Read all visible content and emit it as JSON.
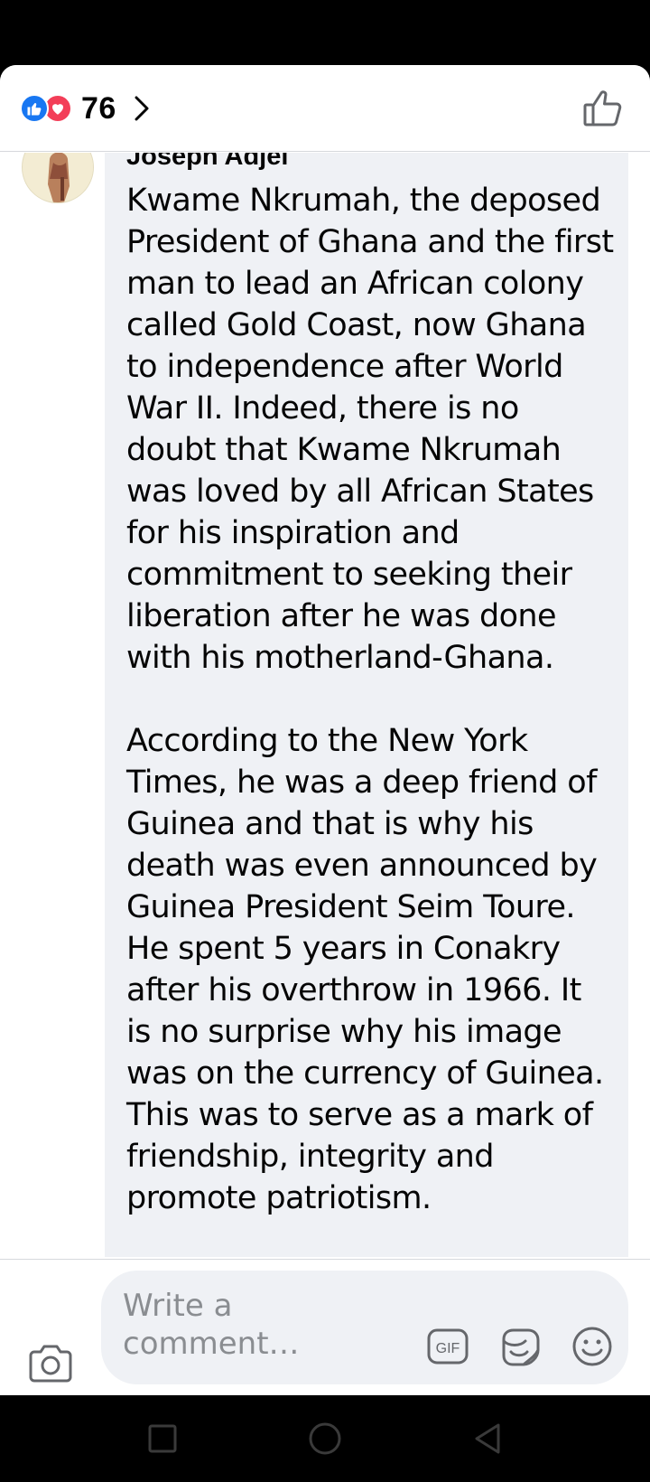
{
  "reactions": {
    "count": "76",
    "types": [
      "like",
      "love"
    ],
    "like_color": "#1877f2",
    "love_color": "#f33e58"
  },
  "comment": {
    "author": "Joseph Adjei",
    "paragraphs": [
      "Kwame Nkrumah, the deposed President of Ghana and the first man to lead an African colony called Gold Coast, now Ghana to independence after World War II. Indeed, there is no doubt that Kwame Nkrumah was loved by all African States for his inspiration and commitment to seeking their liberation after he was done with his motherland-Ghana.",
      "According to the New York Times, he was a deep friend of Guinea and that is why his death was even announced by Guinea President Seim Toure. He spent 5 years in Conakry after his overthrow in 1966. It is no surprise why his image was on the currency of Guinea. This was to serve as a mark of friendship, integrity and promote patriotism."
    ]
  },
  "composer": {
    "placeholder": "Write a comment…",
    "gif_label": "GIF",
    "icons": [
      "camera-icon",
      "gif-icon",
      "sticker-icon",
      "emoji-icon"
    ]
  },
  "navbar": {
    "icons": [
      "recent-apps-icon",
      "home-icon",
      "back-icon"
    ]
  },
  "colors": {
    "bubble": "#eff1f5",
    "text": "#050505",
    "icon_gray": "#65676b"
  }
}
